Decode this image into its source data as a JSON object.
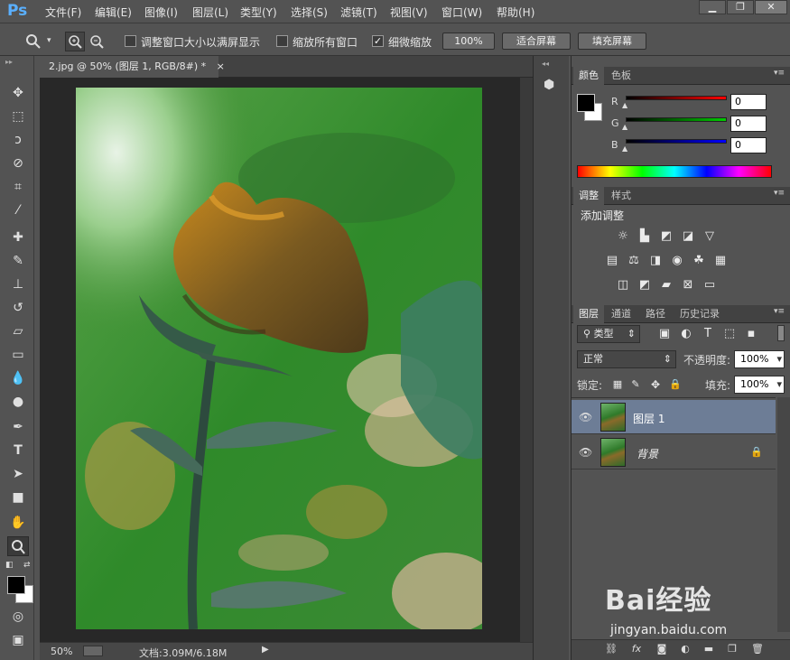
{
  "app": {
    "logo": "Ps"
  },
  "menu": [
    "文件(F)",
    "编辑(E)",
    "图像(I)",
    "图层(L)",
    "类型(Y)",
    "选择(S)",
    "滤镜(T)",
    "视图(V)",
    "窗口(W)",
    "帮助(H)"
  ],
  "window_buttons": {
    "minimize": "▁",
    "restore": "❐",
    "close": "✕"
  },
  "options": {
    "resize_windows_label": "调整窗口大小以满屏显示",
    "zoom_all_label": "缩放所有窗口",
    "scrubby_zoom_label": "细微缩放",
    "btn_100": "100%",
    "btn_fit": "适合屏幕",
    "btn_fill": "填充屏幕"
  },
  "document": {
    "tab_title": "2.jpg @ 50% (图层 1, RGB/8#) *",
    "tab_close": "×",
    "status_zoom": "50%",
    "status_doc": "文档:3.09M/6.18M"
  },
  "color_panel": {
    "tabs": [
      "颜色",
      "色板"
    ],
    "channels": [
      {
        "label": "R",
        "value": "0",
        "color": "#cc0000"
      },
      {
        "label": "G",
        "value": "0",
        "color": "#00bb00"
      },
      {
        "label": "B",
        "value": "0",
        "color": "#0000cc"
      }
    ]
  },
  "adjust_panel": {
    "tabs": [
      "调整",
      "样式"
    ],
    "title": "添加调整",
    "icons_row1": [
      "brightness-icon",
      "levels-icon",
      "curves-icon",
      "exposure-icon",
      "vibrance-icon"
    ],
    "icons_row2": [
      "hue-icon",
      "balance-icon",
      "bw-icon",
      "photofilter-icon",
      "mixer-icon",
      "lookup-icon"
    ],
    "icons_row3": [
      "invert-icon",
      "posterize-icon",
      "threshold-icon",
      "selectivecolor-icon",
      "gradientmap-icon"
    ]
  },
  "layers_panel": {
    "tabs": [
      "图层",
      "通道",
      "路径",
      "历史记录"
    ],
    "filter_label": "类型",
    "blend_mode": "正常",
    "opacity_label": "不透明度:",
    "opacity_value": "100%",
    "lock_label": "锁定:",
    "fill_label": "填充:",
    "fill_value": "100%",
    "layers": [
      {
        "name": "图层 1",
        "selected": true
      },
      {
        "name": "背景",
        "selected": false,
        "locked": true
      }
    ]
  },
  "watermark": {
    "brand": "Bai经验",
    "url": "jingyan.baidu.com"
  }
}
